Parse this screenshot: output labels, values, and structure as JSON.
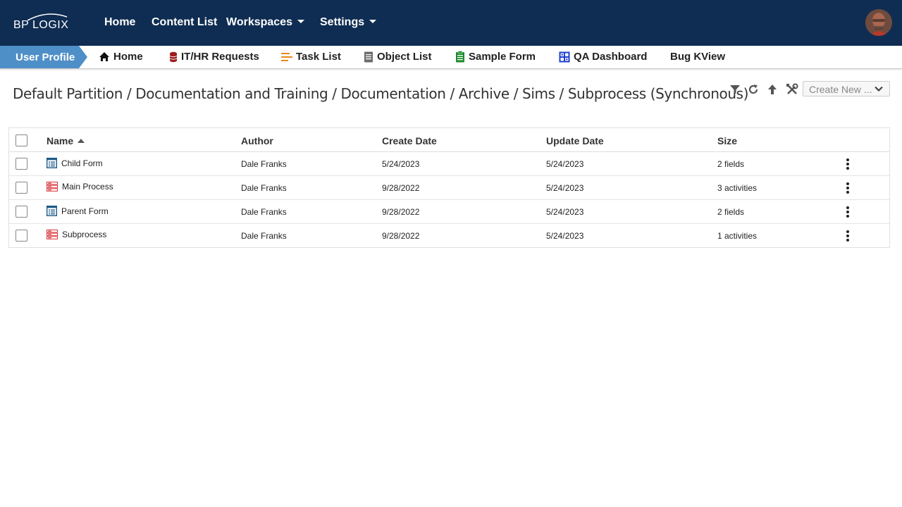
{
  "topbar": {
    "logo_text": "BP LOGIX",
    "nav": [
      {
        "label": "Home"
      },
      {
        "label": "Content List"
      },
      {
        "label": "Workspaces"
      },
      {
        "label": "Settings"
      }
    ],
    "bg_color": "#0f2d52"
  },
  "tabbar": {
    "profile_label": "User Profile",
    "profile_color": "#4f8fc8",
    "tabs": [
      {
        "label": "Home",
        "icon": "home-icon"
      },
      {
        "label": "IT/HR Requests",
        "icon": "database-icon"
      },
      {
        "label": "Task List",
        "icon": "task-list-icon"
      },
      {
        "label": "Object List",
        "icon": "document-icon"
      },
      {
        "label": "Sample Form",
        "icon": "clipboard-icon"
      },
      {
        "label": "QA Dashboard",
        "icon": "dashboard-icon"
      },
      {
        "label": "Bug KView",
        "icon": ""
      }
    ]
  },
  "breadcrumb": "Default Partition / Documentation and Training / Documentation / Archive / Sims / Subprocess (Synchronous)",
  "toolbar": {
    "icons": [
      "filter-icon",
      "refresh-icon",
      "up-arrow-icon",
      "tools-icon"
    ],
    "create_new_label": "Create New ..."
  },
  "table": {
    "headers": {
      "name": "Name",
      "author": "Author",
      "create_date": "Create Date",
      "update_date": "Update Date",
      "size": "Size"
    },
    "sort": {
      "column": "name",
      "direction": "ascending"
    },
    "rows": [
      {
        "type": "form",
        "name": "Child Form",
        "author": "Dale Franks",
        "create_date": "5/24/2023",
        "update_date": "5/24/2023",
        "size": "2 fields"
      },
      {
        "type": "process",
        "name": "Main Process",
        "author": "Dale Franks",
        "create_date": "9/28/2022",
        "update_date": "5/24/2023",
        "size": "3 activities"
      },
      {
        "type": "form",
        "name": "Parent Form",
        "author": "Dale Franks",
        "create_date": "9/28/2022",
        "update_date": "5/24/2023",
        "size": "2 fields"
      },
      {
        "type": "process",
        "name": "Subprocess",
        "author": "Dale Franks",
        "create_date": "9/28/2022",
        "update_date": "5/24/2023",
        "size": "1 activities"
      }
    ]
  }
}
